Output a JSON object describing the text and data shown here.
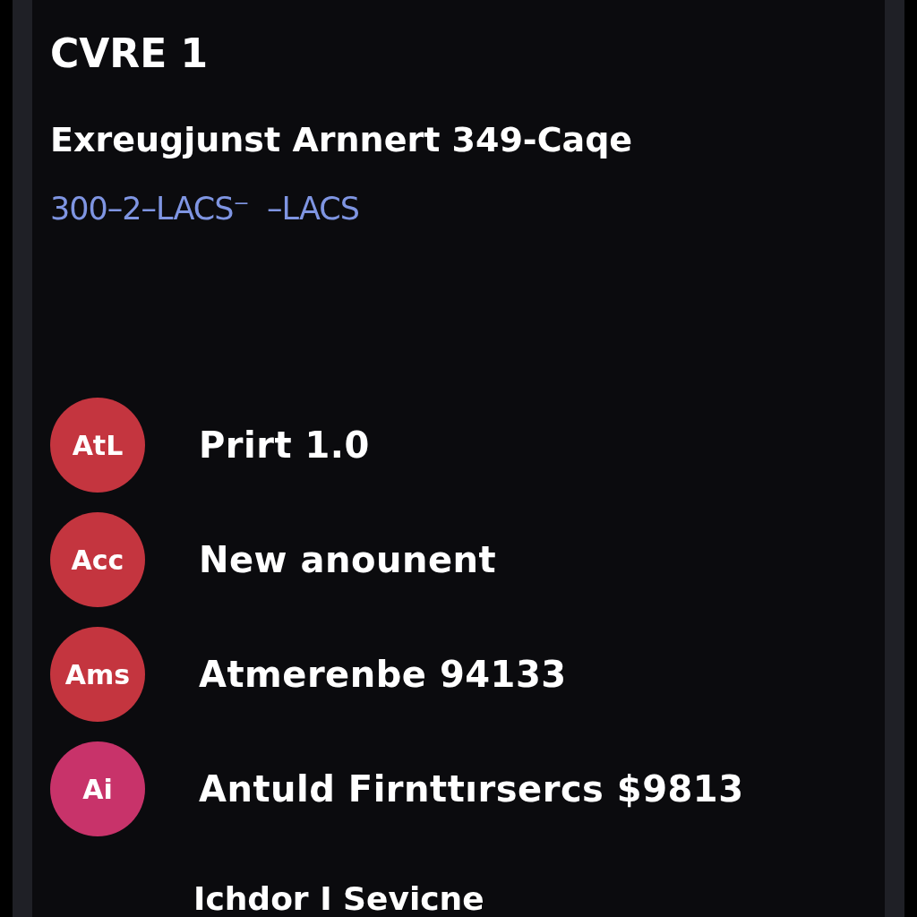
{
  "header": {
    "title": "CVRE 1",
    "subtitle": "Exreugjunst Arnnert 349-Caqe",
    "meta": "300–2–LACS⁻  –LACS"
  },
  "items": [
    {
      "badge": "AtL",
      "label": "Prirt 1.0",
      "color": "#c4353f"
    },
    {
      "badge": "Acc",
      "label": "New anounent",
      "color": "#c4353f"
    },
    {
      "badge": "Ams",
      "label": "Atmerenbe 94133",
      "color": "#c4353f"
    },
    {
      "badge": "Ai",
      "label": "Antuld Firnttırsercs $9813",
      "color": "#c8336a"
    }
  ],
  "footer": {
    "label": "Ichdor I Sevicne"
  }
}
